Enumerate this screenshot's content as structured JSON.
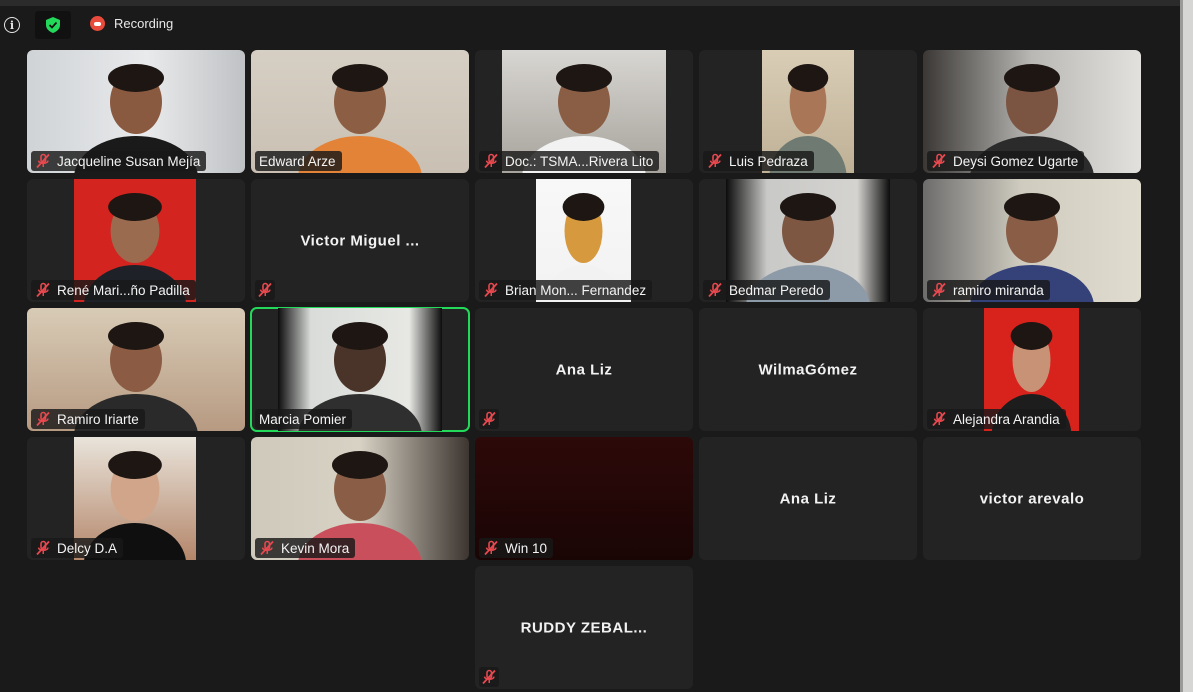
{
  "header": {
    "info_icon": "info-icon",
    "shield_icon": "shield-icon",
    "recording_icon": "recording-icon",
    "recording_label": "Recording"
  },
  "colors": {
    "active_speaker": "#23d959",
    "muted_mic": "#e8484e",
    "recording": "#e84b3c",
    "shield": "#23d959"
  },
  "participants": [
    {
      "name": "Jacqueline Susan Mejía",
      "muted": true,
      "video": true
    },
    {
      "name": "Edward Arze",
      "muted": false,
      "video": true
    },
    {
      "name": "Doc.: TSMA...Rivera Lito",
      "muted": true,
      "video": true
    },
    {
      "name": "Luis Pedraza",
      "muted": true,
      "video": true
    },
    {
      "name": "Deysi Gomez Ugarte",
      "muted": true,
      "video": true
    },
    {
      "name": "René Mari...ño Padilla",
      "muted": true,
      "video": true
    },
    {
      "name": "Victor Miguel ...",
      "muted": true,
      "video": false
    },
    {
      "name": "Brian Mon... Fernandez",
      "muted": true,
      "video": true
    },
    {
      "name": "Bedmar Peredo",
      "muted": true,
      "video": true
    },
    {
      "name": "ramiro miranda",
      "muted": true,
      "video": true
    },
    {
      "name": "Ramiro Iriarte",
      "muted": true,
      "video": true
    },
    {
      "name": "Marcia Pomier",
      "muted": false,
      "video": true,
      "active": true
    },
    {
      "name": "Ana Liz",
      "muted": true,
      "video": false
    },
    {
      "name": "WilmaGómez",
      "muted": false,
      "video": false
    },
    {
      "name": "Alejandra Arandia",
      "muted": true,
      "video": true
    },
    {
      "name": "Delcy D.A",
      "muted": true,
      "video": true
    },
    {
      "name": "Kevin Mora",
      "muted": true,
      "video": true
    },
    {
      "name": "Win 10",
      "muted": true,
      "video": true
    },
    {
      "name": "Ana Liz",
      "muted": false,
      "video": false
    },
    {
      "name": "victor arevalo",
      "muted": false,
      "video": false
    },
    {
      "name": "RUDDY ZEBAL...",
      "muted": true,
      "video": false
    }
  ]
}
